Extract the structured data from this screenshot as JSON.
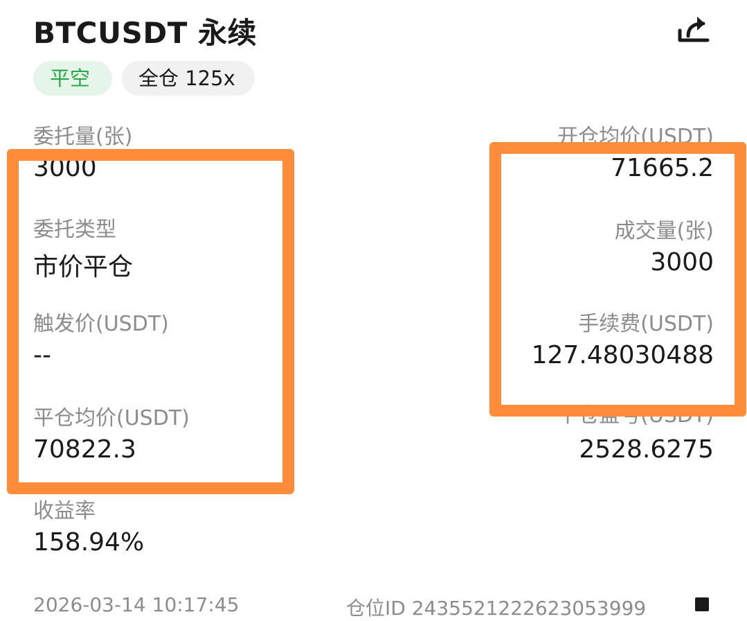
{
  "header": {
    "title": "BTCUSDT 永续",
    "share_icon": "share-icon"
  },
  "tags": {
    "side": "平空",
    "mode": "全仓 125x"
  },
  "left": {
    "order_qty_label": "委托量(张)",
    "order_qty_value": "3000",
    "order_type_label": "委托类型",
    "order_type_value": "市价平仓",
    "trigger_price_label": "触发价(USDT)",
    "trigger_price_value": "--",
    "close_avg_label": "平仓均价(USDT)",
    "close_avg_value": "70822.3",
    "roi_label": "收益率",
    "roi_value": "158.94%"
  },
  "right": {
    "open_avg_label": "开仓均价(USDT)",
    "open_avg_value": "71665.2",
    "filled_qty_label": "成交量(张)",
    "filled_qty_value": "3000",
    "fee_label": "手续费(USDT)",
    "fee_value": "127.48030488",
    "pnl_label": "平仓盈亏(USDT)",
    "pnl_value": "2528.6275"
  },
  "footer": {
    "time": "2026-03-14 10:17:45",
    "position_id": "仓位ID 2435521222623053999"
  },
  "colors": {
    "highlight": "#ff8c3a",
    "tag_green_text": "#28a745",
    "tag_green_bg": "#e6f5ea"
  }
}
